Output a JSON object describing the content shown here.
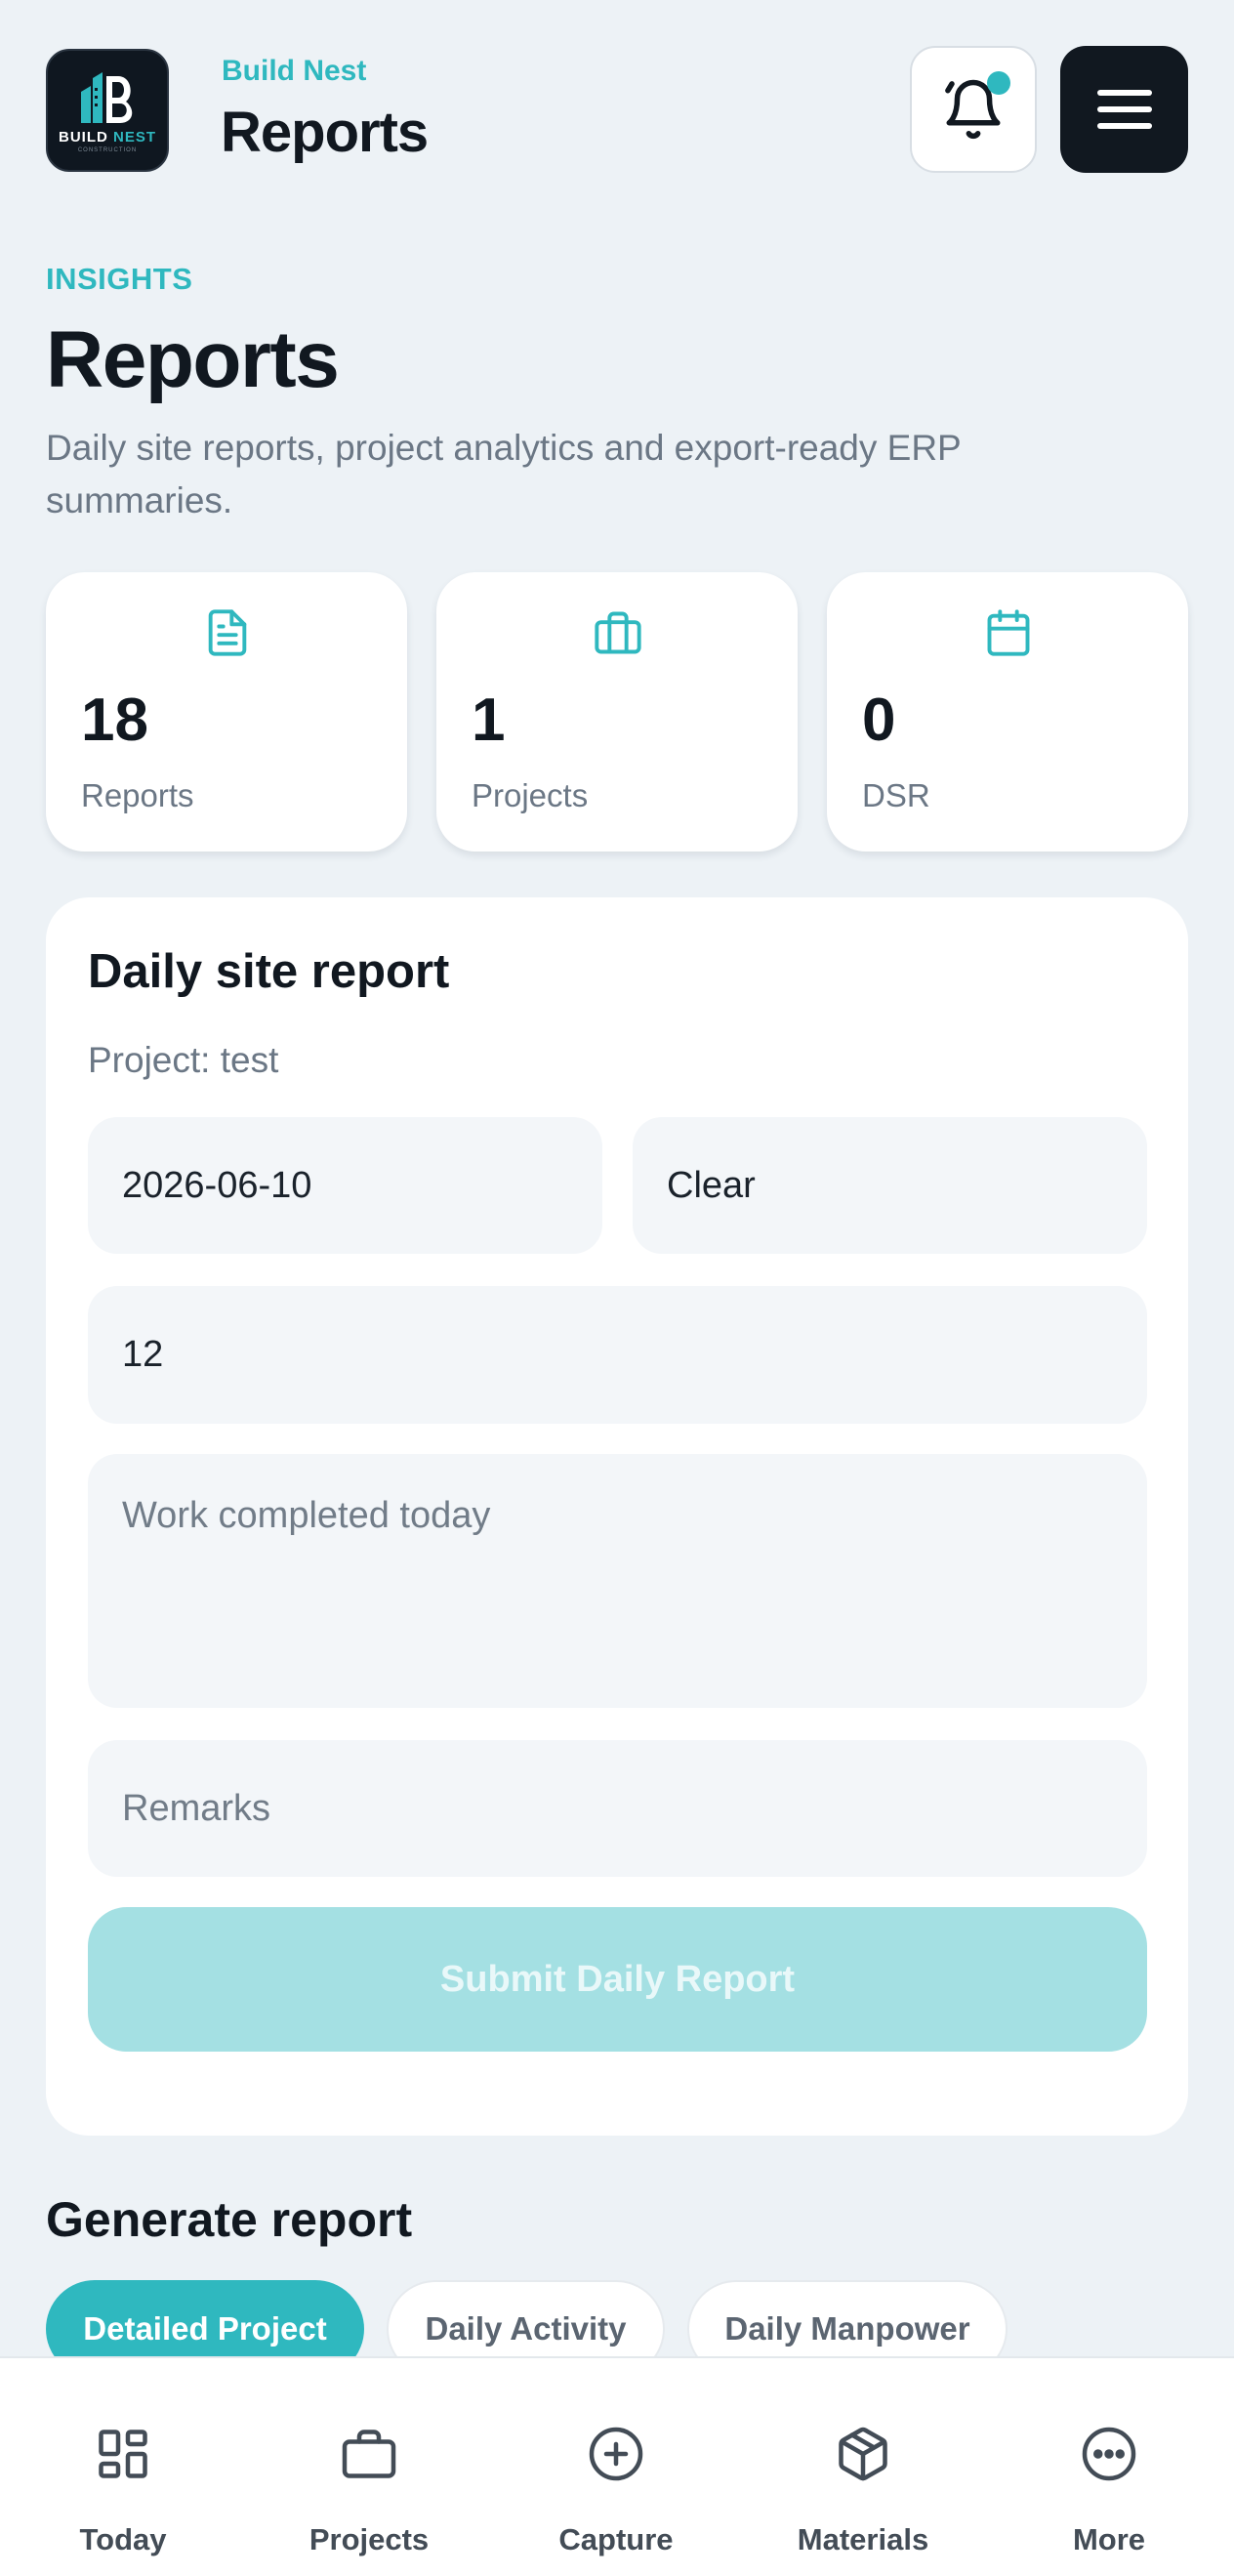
{
  "app": {
    "brand": "Build Nest",
    "title": "Reports",
    "logo_text": "BUILD",
    "logo_text_accent": "NEST",
    "logo_subtext": "CONSTRUCTION"
  },
  "header": {
    "notification_icon": "bell-icon",
    "menu_icon": "hamburger-icon",
    "notification_badge": true
  },
  "intro": {
    "eyebrow": "INSIGHTS",
    "heading": "Reports",
    "description": "Daily site reports, project analytics and export-ready ERP summaries."
  },
  "stats": [
    {
      "icon": "document-icon",
      "value": "18",
      "label": "Reports"
    },
    {
      "icon": "briefcase-icon",
      "value": "1",
      "label": "Projects"
    },
    {
      "icon": "calendar-icon",
      "value": "0",
      "label": "DSR"
    }
  ],
  "daily_report": {
    "title": "Daily site report",
    "project_line": "Project: test",
    "date_value": "2026-06-10",
    "clear_label": "Clear",
    "manpower_value": "12",
    "work_placeholder": "Work completed today",
    "remarks_placeholder": "Remarks",
    "submit_label": "Submit Daily Report"
  },
  "generate": {
    "title": "Generate report",
    "chips": [
      {
        "label": "Detailed Project",
        "active": true
      },
      {
        "label": "Daily Activity",
        "active": false
      },
      {
        "label": "Daily Manpower",
        "active": false
      }
    ]
  },
  "bottom_nav": [
    {
      "label": "Today",
      "icon": "dashboard-icon"
    },
    {
      "label": "Projects",
      "icon": "briefcase-icon"
    },
    {
      "label": "Capture",
      "icon": "plus-circle-icon"
    },
    {
      "label": "Materials",
      "icon": "box-icon"
    },
    {
      "label": "More",
      "icon": "more-icon"
    }
  ],
  "colors": {
    "accent": "#2fb8bf",
    "background": "#edf2f6",
    "dark": "#111820",
    "submit_disabled": "#a4e0e3"
  }
}
